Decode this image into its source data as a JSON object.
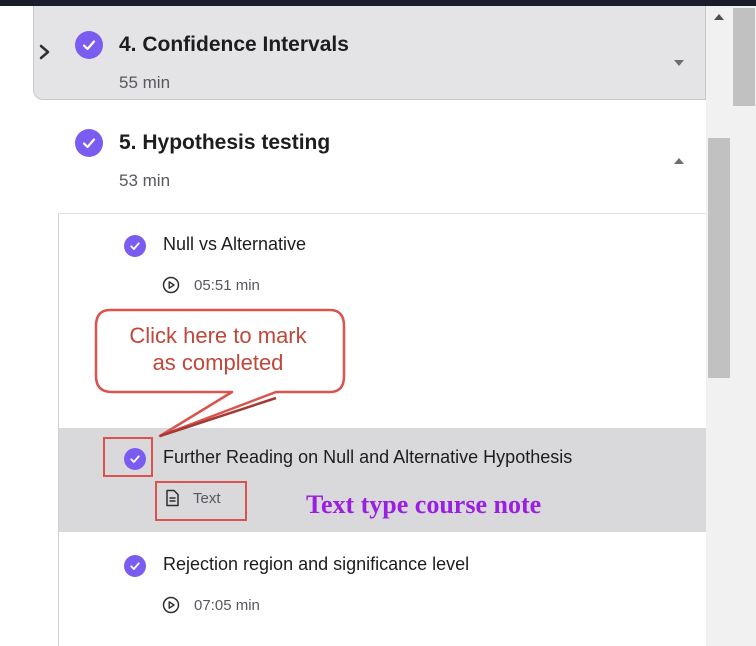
{
  "sections": [
    {
      "title": "4. Confidence Intervals",
      "duration": "55 min",
      "completed": true,
      "expanded": false
    },
    {
      "title": "5. Hypothesis testing",
      "duration": "53 min",
      "completed": true,
      "expanded": true
    }
  ],
  "lectures": [
    {
      "title": "Null vs Alternative",
      "meta": "05:51 min",
      "meta_icon": "play-circle-icon",
      "completed": true
    },
    {
      "title": "Further Reading on Null and Alternative Hypothesis",
      "meta": "Text",
      "meta_icon": "document-icon",
      "completed": true,
      "highlighted": true
    },
    {
      "title": "Rejection region and significance level",
      "meta": "07:05 min",
      "meta_icon": "play-circle-icon",
      "completed": true
    }
  ],
  "annotations": {
    "callout_line1": "Click here to mark",
    "callout_line2": "as completed",
    "text_note": "Text type course note"
  },
  "colors": {
    "accent": "#7b5cf0",
    "annotation_red": "#d9534f",
    "annotation_purple": "#9b1fe0",
    "highlight_row": "#d9d9dc"
  }
}
